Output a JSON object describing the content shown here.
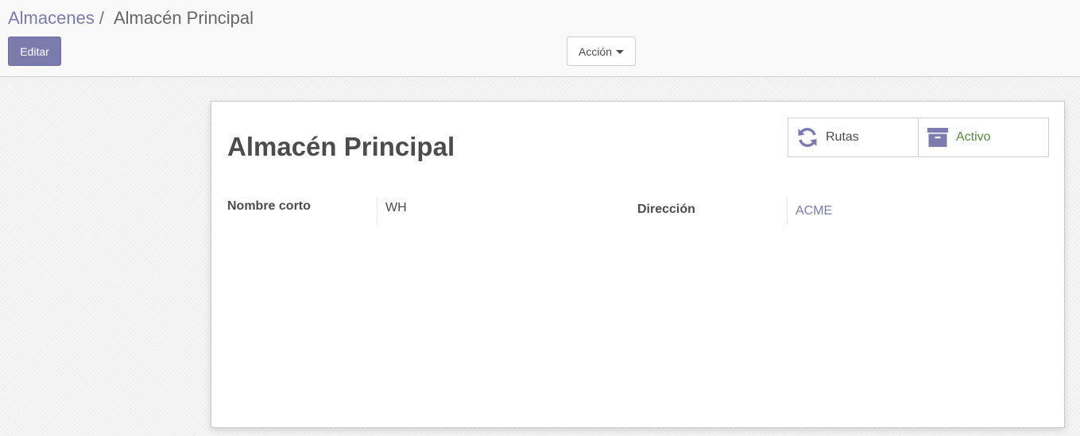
{
  "breadcrumb": {
    "parent": "Almacenes",
    "separator": "/",
    "current": "Almacén Principal"
  },
  "buttons": {
    "edit": "Editar",
    "action": "Acción"
  },
  "record": {
    "title": "Almacén Principal",
    "smart_buttons": [
      {
        "label": "Rutas",
        "icon": "refresh-icon"
      },
      {
        "label": "Activo",
        "icon": "archive-icon"
      }
    ],
    "fields": {
      "short_name_label": "Nombre corto",
      "short_name_value": "WH",
      "address_label": "Dirección",
      "address_value": "ACME"
    }
  },
  "colors": {
    "primary": "#7c7bad",
    "active_text": "#558a3d"
  }
}
